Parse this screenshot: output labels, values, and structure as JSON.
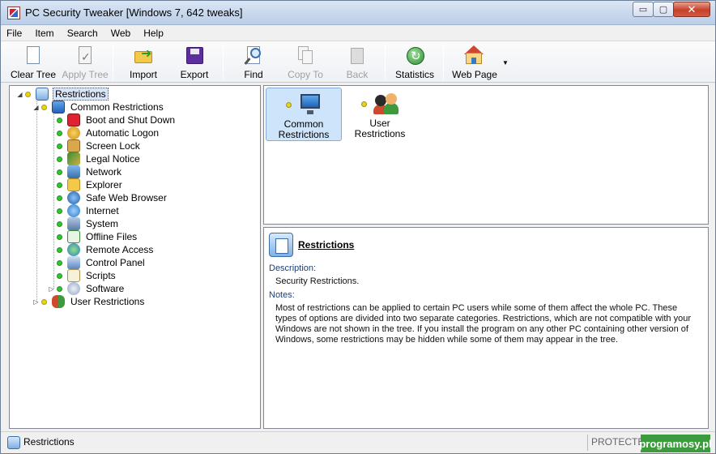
{
  "window": {
    "title": "PC Security Tweaker [Windows 7, 642 tweaks]",
    "buttons": {
      "minimize": "▭",
      "maximize": "▢",
      "close": "✕"
    }
  },
  "menu": [
    "File",
    "Item",
    "Search",
    "Web",
    "Help"
  ],
  "toolbar": {
    "buttons": [
      {
        "label": "Clear Tree",
        "icon": "clear-tree-icon",
        "enabled": true
      },
      {
        "label": "Apply Tree",
        "icon": "apply-tree-icon",
        "enabled": false
      },
      {
        "label": "Import",
        "icon": "import-icon",
        "enabled": true
      },
      {
        "label": "Export",
        "icon": "export-icon",
        "enabled": true
      },
      {
        "label": "Find",
        "icon": "find-icon",
        "enabled": true
      },
      {
        "label": "Copy To",
        "icon": "copy-icon",
        "enabled": false
      },
      {
        "label": "Back",
        "icon": "back-icon",
        "enabled": false
      },
      {
        "label": "Statistics",
        "icon": "statistics-icon",
        "enabled": true
      },
      {
        "label": "Web Page",
        "icon": "home-icon",
        "enabled": true
      }
    ],
    "dropdown_arrow": "▼"
  },
  "tree": {
    "root": "Restrictions",
    "common": "Common Restrictions",
    "children": [
      "Boot and Shut Down",
      "Automatic Logon",
      "Screen Lock",
      "Legal Notice",
      "Network",
      "Explorer",
      "Safe Web Browser",
      "Internet",
      "System",
      "Offline Files",
      "Remote Access",
      "Control Panel",
      "Scripts",
      "Software"
    ],
    "user": "User Restrictions"
  },
  "icons_view": {
    "items": [
      {
        "line1": "Common",
        "line2": "Restrictions"
      },
      {
        "line1": "User",
        "line2": "Restrictions"
      }
    ]
  },
  "details": {
    "title": "Restrictions",
    "description_label": "Description:",
    "description": "Security Restrictions.",
    "notes_label": "Notes:",
    "notes": "Most of restrictions can be applied to certain PC users while some of them affect the whole PC. These types of options are divided into two separate categories. Restrictions, which are not compatible with your Windows are not shown in the tree. If you install the program on any other PC containing other version of Windows, some restrictions may be hidden while some of them may appear in the tree."
  },
  "status": {
    "text": "Restrictions",
    "protected": "PROTECTED",
    "watermark": "programosy.pl"
  },
  "colors": {
    "selection": "#cde4fa",
    "green_dot": "#36c236",
    "yellow_dot": "#e8d21a"
  }
}
